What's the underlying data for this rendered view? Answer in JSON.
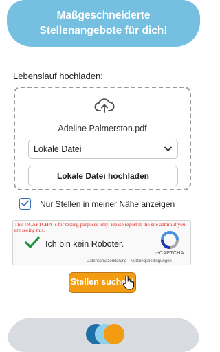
{
  "header": {
    "line1": "Maßgeschneiderte",
    "line2": "Stellenangebote für dich!"
  },
  "upload": {
    "label": "Lebenslauf hochladen:",
    "icon": "cloud-upload-icon",
    "filename": "Adeline Palmerston.pdf",
    "source_select": "Lokale Datei",
    "local_button": "Lokale Datei hochladen"
  },
  "nearby": {
    "label": "Nur Stellen in meiner Nähe anzeigen",
    "checked": true
  },
  "captcha": {
    "warning": "This reCAPTCHA is for testing purposes only. Please report to the site admin if you are seeing this.",
    "label": "Ich bin kein Roboter.",
    "brand": "reCAPTCHA",
    "links": "Datenschutzerklärung - Nutzungsbedingungen",
    "checked": true
  },
  "search_button": "Stellen suchen!",
  "colors": {
    "header": "#75bfe0",
    "accent": "#f39c12",
    "footer": "#d8dbe0",
    "check": "#1e8e3e"
  }
}
